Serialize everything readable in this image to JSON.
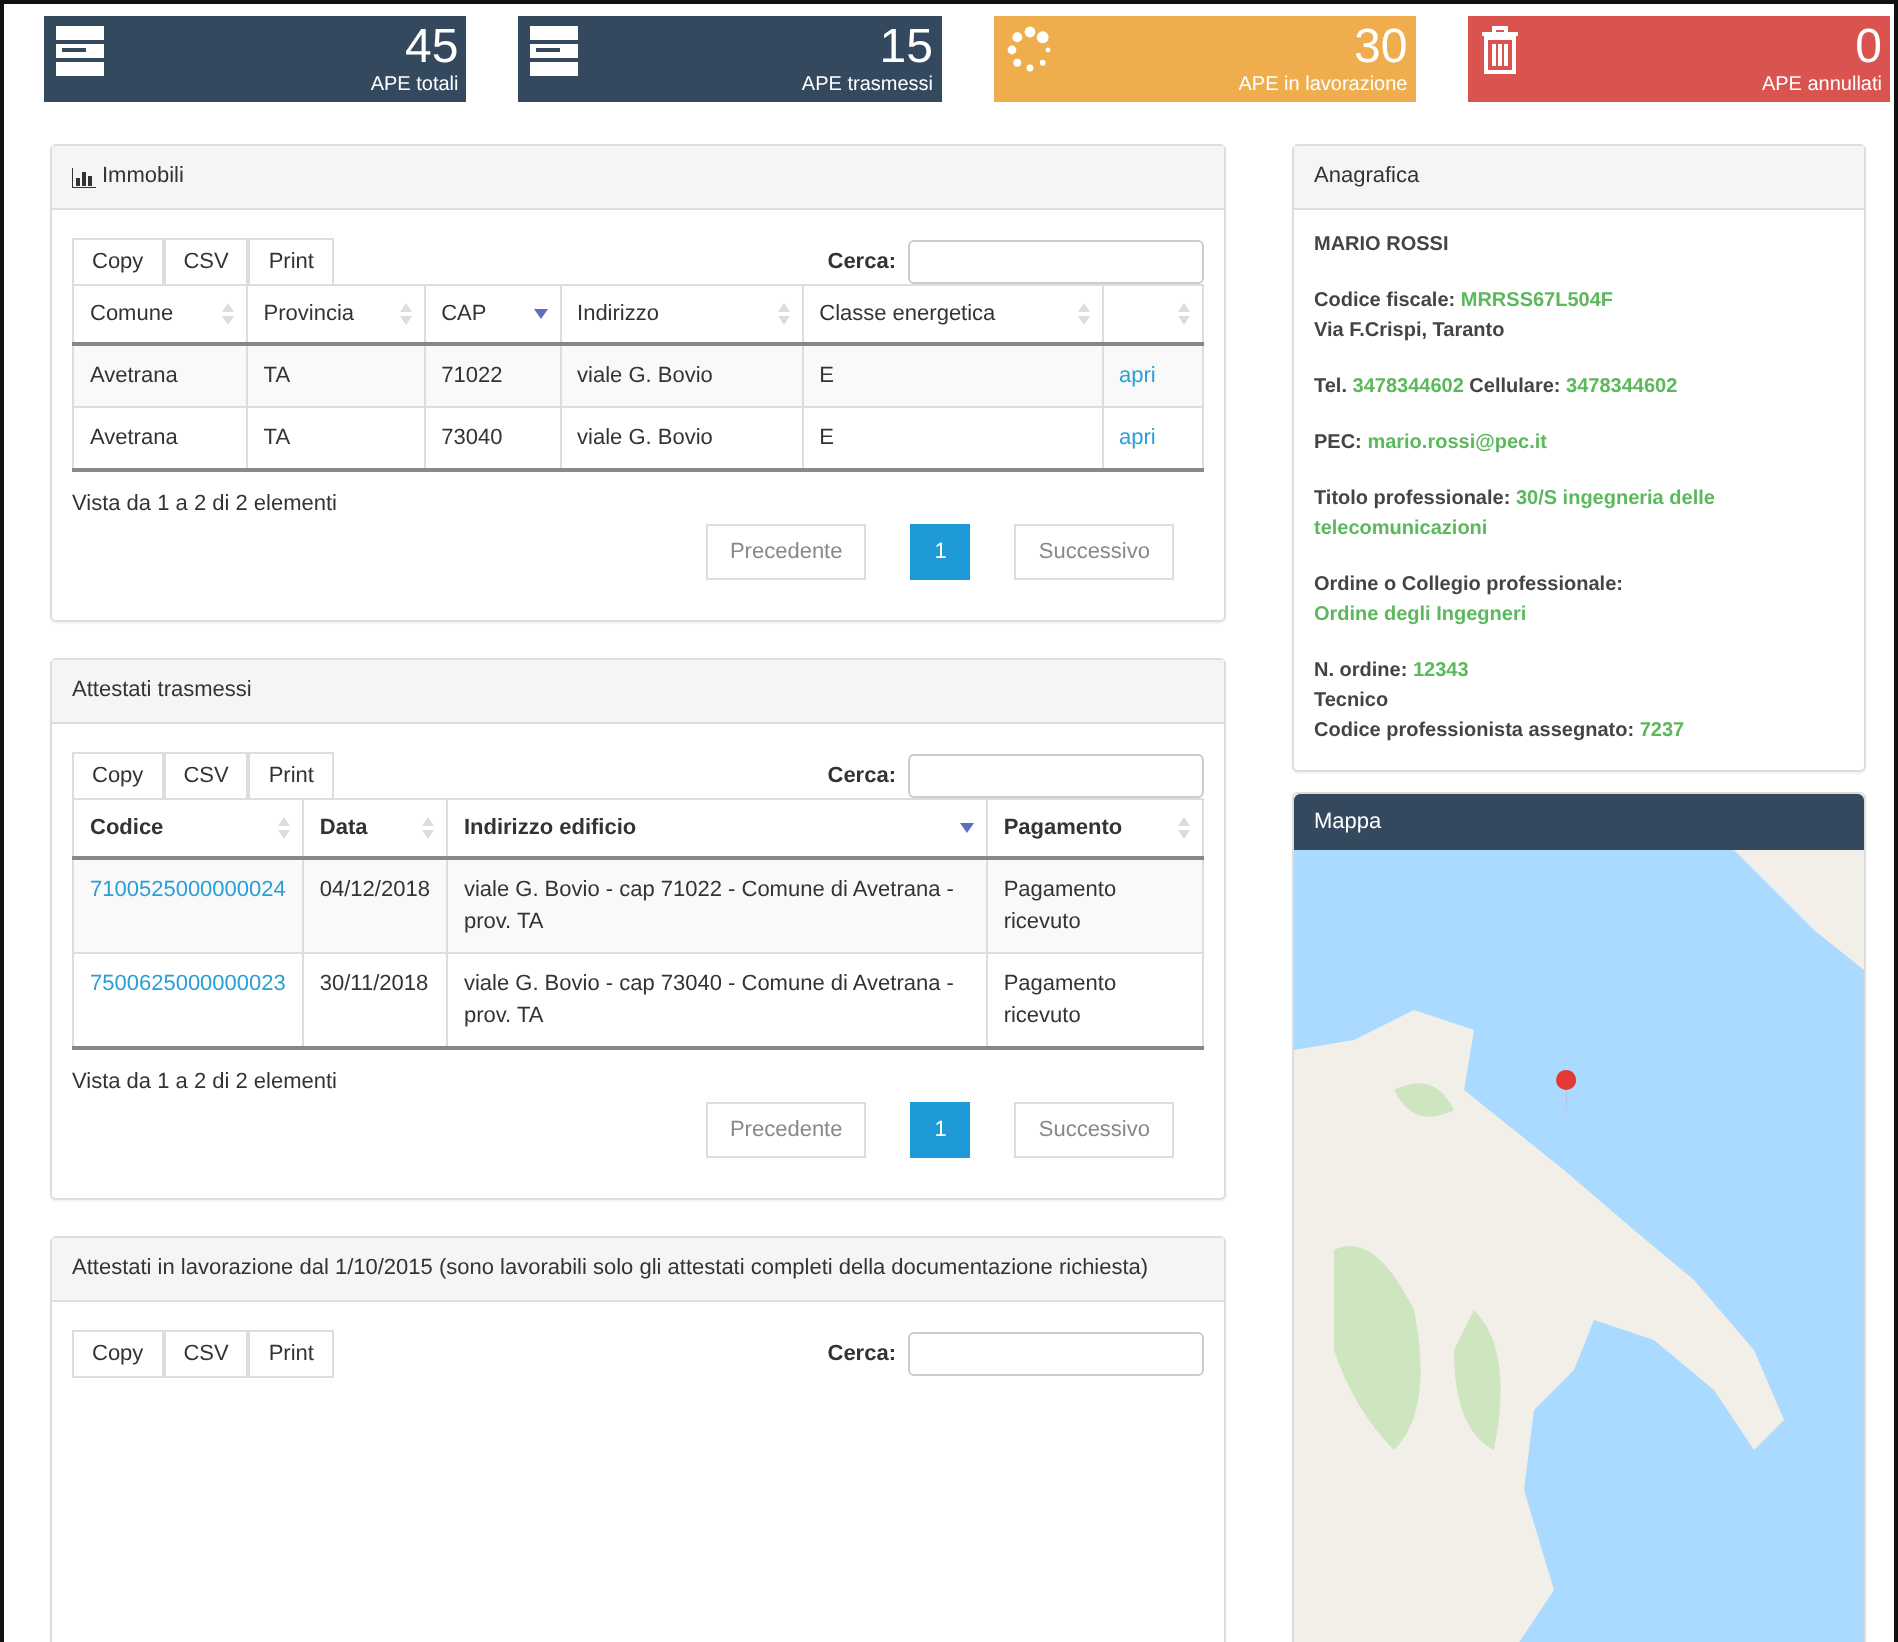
{
  "stats": [
    {
      "kind": "server",
      "value": "45",
      "label": "APE totali",
      "color": "#34495e"
    },
    {
      "kind": "server",
      "value": "15",
      "label": "APE trasmessi",
      "color": "#34495e"
    },
    {
      "kind": "spinner",
      "value": "30",
      "label": "APE in lavorazione",
      "color": "#f0ad4e"
    },
    {
      "kind": "trash",
      "value": "0",
      "label": "APE annullati",
      "color": "#d9534f"
    }
  ],
  "panels": [
    {
      "title": "Immobili",
      "toolbar": [
        "Copy",
        "CSV",
        "Print"
      ],
      "search_label": "Cerca:",
      "columns": [
        {
          "label": "Comune",
          "sorted": false,
          "kind": "text"
        },
        {
          "label": "Provincia",
          "sorted": false,
          "kind": "text"
        },
        {
          "label": "CAP",
          "sorted": true,
          "kind": "text"
        },
        {
          "label": "Indirizzo",
          "sorted": false,
          "kind": "text"
        },
        {
          "label": "Classe energetica",
          "sorted": false,
          "kind": "text"
        },
        {
          "sorted": false,
          "kind": "link"
        }
      ],
      "rows": [
        [
          "Avetrana",
          "TA",
          "71022",
          "viale G. Bovio",
          "E",
          "apri"
        ],
        [
          "Avetrana",
          "TA",
          "73040",
          "viale G. Bovio",
          "E",
          "apri"
        ]
      ],
      "info": "Vista da 1 a 2 di 2 elementi",
      "prev": "Precedente",
      "pages": [
        {
          "label": "1",
          "selected": true
        }
      ],
      "next": "Successivo"
    },
    {
      "title": "Attestati trasmessi",
      "toolbar": [
        "Copy",
        "CSV",
        "Print"
      ],
      "search_label": "Cerca:",
      "columns": [
        {
          "label": "Codice",
          "sorted": false,
          "kind": "link"
        },
        {
          "label": "Data",
          "sorted": false,
          "kind": "text"
        },
        {
          "label": "Indirizzo edificio",
          "sorted": true,
          "kind": "text"
        },
        {
          "label": "Pagamento",
          "sorted": false,
          "kind": "text"
        }
      ],
      "rows": [
        [
          "7100525000000024",
          "04/12/2018",
          "viale G. Bovio - cap 71022 - Comune di Avetrana - prov. TA",
          "Pagamento ricevuto"
        ],
        [
          "7500625000000023",
          "30/11/2018",
          "viale G. Bovio - cap 73040 - Comune di Avetrana - prov. TA",
          "Pagamento ricevuto"
        ]
      ],
      "info": "Vista da 1 a 2 di 2 elementi",
      "prev": "Precedente",
      "pages": [
        {
          "label": "1",
          "selected": true
        }
      ],
      "next": "Successivo"
    },
    {
      "title": "Attestati in lavorazione dal 1/10/2015 (sono lavorabili solo gli attestati completi della documentazione richiesta)",
      "toolbar": [
        "Copy",
        "CSV",
        "Print"
      ],
      "search_label": "Cerca:"
    }
  ],
  "anagrafica": {
    "title": "Anagrafica",
    "groups": [
      [
        [
          {
            "kind": "label",
            "text": "MARIO ROSSI"
          }
        ]
      ],
      [
        [
          {
            "kind": "label",
            "text": "Codice fiscale:"
          },
          {
            "kind": "value",
            "text": "MRRSS67L504F"
          }
        ],
        [
          {
            "kind": "label",
            "text": "Via F.Crispi, Taranto"
          }
        ]
      ],
      [
        [
          {
            "kind": "label",
            "text": "Tel."
          },
          {
            "kind": "value",
            "text": "3478344602"
          },
          {
            "kind": "label",
            "text": "Cellulare:"
          },
          {
            "kind": "value",
            "text": "3478344602"
          }
        ]
      ],
      [
        [
          {
            "kind": "label",
            "text": "PEC:"
          },
          {
            "kind": "value",
            "text": "mario.rossi@pec.it"
          }
        ]
      ],
      [
        [
          {
            "kind": "label",
            "text": "Titolo professionale:"
          },
          {
            "kind": "value",
            "text": "30/S ingegneria delle telecomunicazioni"
          }
        ]
      ],
      [
        [
          {
            "kind": "label",
            "text": "Ordine o Collegio professionale:"
          }
        ],
        [
          {
            "kind": "value",
            "text": "Ordine degli Ingegneri"
          }
        ]
      ],
      [
        [
          {
            "kind": "label",
            "text": "N. ordine:"
          },
          {
            "kind": "value",
            "text": "12343"
          }
        ],
        [
          {
            "kind": "label",
            "text": "Tecnico"
          }
        ],
        [
          {
            "kind": "label",
            "text": "Codice professionista assegnato:"
          },
          {
            "kind": "value",
            "text": "7237"
          }
        ]
      ]
    ]
  },
  "map": {
    "title": "Mappa"
  }
}
